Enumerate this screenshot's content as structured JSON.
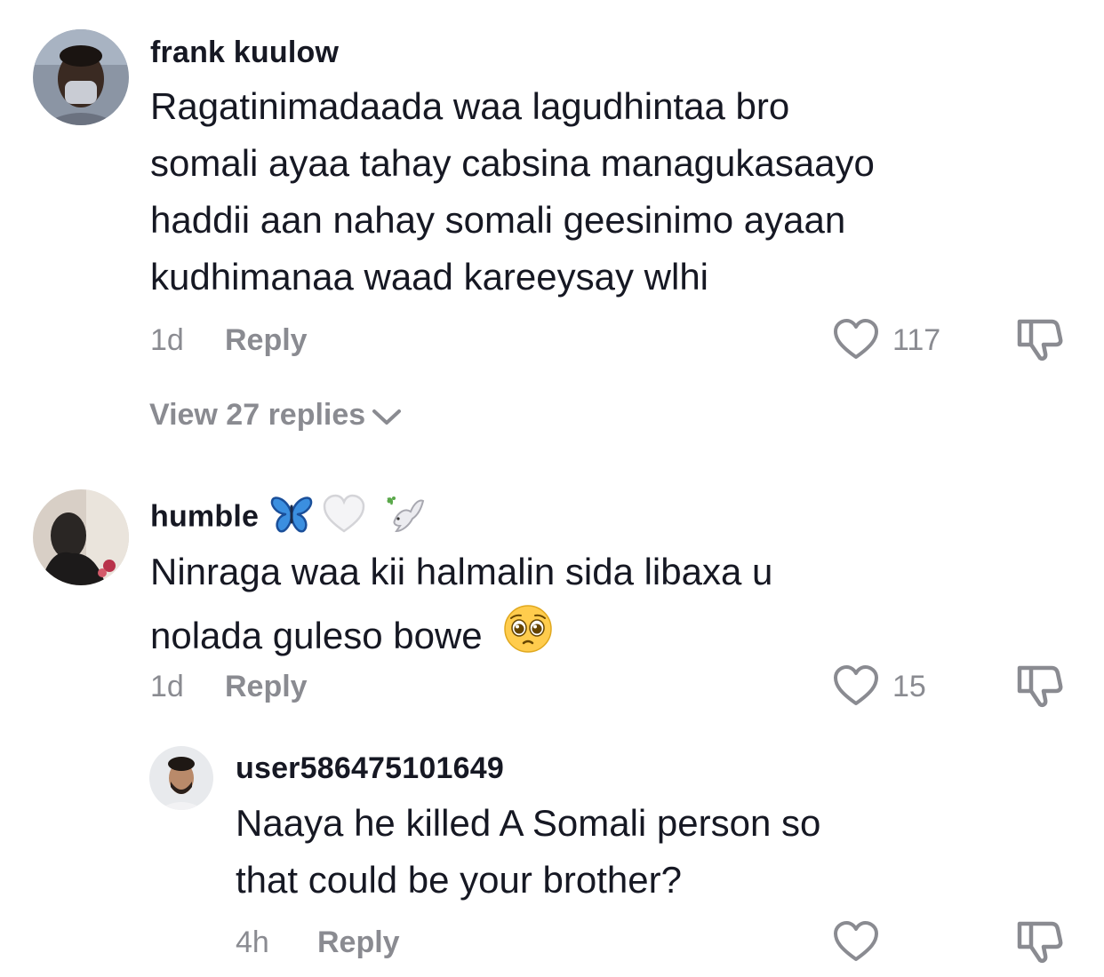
{
  "comments": [
    {
      "username": "frank kuulow",
      "lines": [
        "Ragatinimadaada waa lagudhintaa bro",
        "somali ayaa tahay cabsina managukasaayo",
        "haddii aan nahay somali geesinimo ayaan",
        "kudhimanaa waad kareeysay wlhi"
      ],
      "time": "1d",
      "reply_label": "Reply",
      "likes": "117",
      "view_replies": "View 27 replies",
      "avatar_icon": "avatar-photo"
    },
    {
      "username": "humble",
      "username_emojis": [
        "butterfly-emoji",
        "white-heart-emoji",
        "dove-emoji"
      ],
      "lines": [
        "Ninraga waa kii halmalin sida libaxa u",
        "nolada guleso bowe"
      ],
      "text_emoji": "pleading-face-emoji",
      "time": "1d",
      "reply_label": "Reply",
      "likes": "15",
      "avatar_icon": "avatar-photo"
    },
    {
      "username": "user586475101649",
      "lines": [
        "Naaya he killed A Somali person so",
        "that could be your brother?"
      ],
      "time": "4h",
      "reply_label": "Reply",
      "avatar_icon": "avatar-photo"
    }
  ],
  "colors": {
    "primary_text": "#161823",
    "secondary_text": "#8a8b91",
    "background": "#ffffff",
    "butterfly_blue": "#3b8fe0"
  }
}
